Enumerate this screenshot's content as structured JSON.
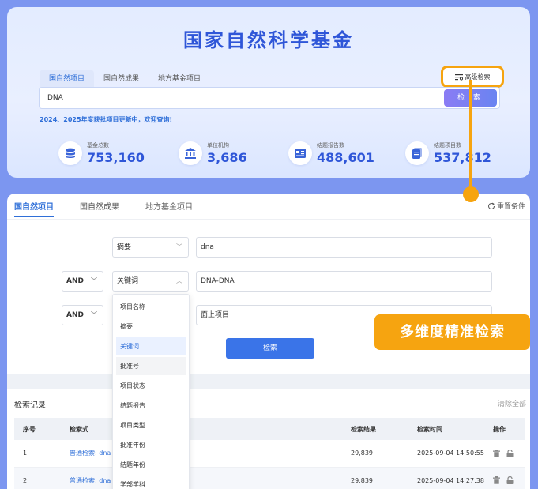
{
  "header": {
    "title": "国家自然科学基金",
    "tabs": [
      "国自然项目",
      "国自然成果",
      "地方基金项目"
    ],
    "advanced_search_label": "高级检索",
    "search_value": "DNA",
    "search_button_label": "检 索",
    "notice": "2024、2025年度获批项目更新中，欢迎查询!"
  },
  "stats": [
    {
      "label": "基金总数",
      "value": "753,160",
      "icon": "database-icon"
    },
    {
      "label": "单位机构",
      "value": "3,686",
      "icon": "institution-icon"
    },
    {
      "label": "结题报告数",
      "value": "488,601",
      "icon": "report-icon"
    },
    {
      "label": "结题项目数",
      "value": "537,812",
      "icon": "document-icon"
    }
  ],
  "panel": {
    "tabs": [
      "国自然项目",
      "国自然成果",
      "地方基金项目"
    ],
    "reset_label": "重置条件",
    "rows": [
      {
        "operator": "",
        "field": "摘要",
        "value": "dna"
      },
      {
        "operator": "AND",
        "field": "关键词",
        "value": "DNA-DNA"
      },
      {
        "operator": "AND",
        "field": "",
        "value": "面上项目"
      }
    ],
    "submit_label": "检索",
    "dropdown_options": [
      "项目名称",
      "摘要",
      "关键词",
      "批准号",
      "项目状态",
      "结题报告",
      "项目类型",
      "批准年份",
      "结题年份",
      "学部学科"
    ]
  },
  "history": {
    "title": "检索记录",
    "clear_label": "清除全部",
    "columns": [
      "序号",
      "检索式",
      "检索结果",
      "检索时间",
      "操作"
    ],
    "rows": [
      {
        "index": "1",
        "query": "普通检索: dna",
        "results": "29,839",
        "time": "2025-09-04 14:50:55"
      },
      {
        "index": "2",
        "query": "普通检索: dna",
        "results": "29,839",
        "time": "2025-09-04 14:27:38"
      }
    ]
  },
  "badge": "多维度精准检索",
  "colors": {
    "accent": "#2f56d8",
    "orange": "#f6a410",
    "button": "#3a74e8"
  }
}
